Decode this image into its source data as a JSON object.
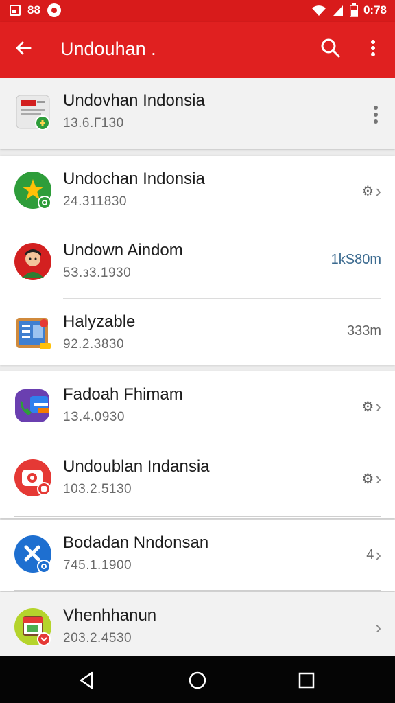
{
  "status_bar": {
    "left_text": "88",
    "time": "0:78"
  },
  "app_bar": {
    "title": "Undouhan ."
  },
  "items": [
    {
      "name": "Undovhan Indonsia",
      "sub": "13.6.Г130",
      "right": ""
    },
    {
      "name": "Undochan Indonsia",
      "sub": "24.311830",
      "right": "⚙"
    },
    {
      "name": "Undown Aindom",
      "sub": "5З.з3.1930",
      "right": "1kЅ80m"
    },
    {
      "name": "Halyzable",
      "sub": "92.2.3830",
      "right": "333m"
    },
    {
      "name": "Fadoah Fhimam",
      "sub": "1З.4.0930",
      "right": "⚙"
    },
    {
      "name": "Undoublan Indansia",
      "sub": "103.2.5130",
      "right": "⚙"
    },
    {
      "name": "Bodadan Nndonsan",
      "sub": "745.1.1900",
      "right": "4"
    },
    {
      "name": "Vhenhhanun",
      "sub": "203.2.4530",
      "right": ""
    }
  ],
  "colors": {
    "primary": "#e02020",
    "status": "#d81b1b"
  }
}
